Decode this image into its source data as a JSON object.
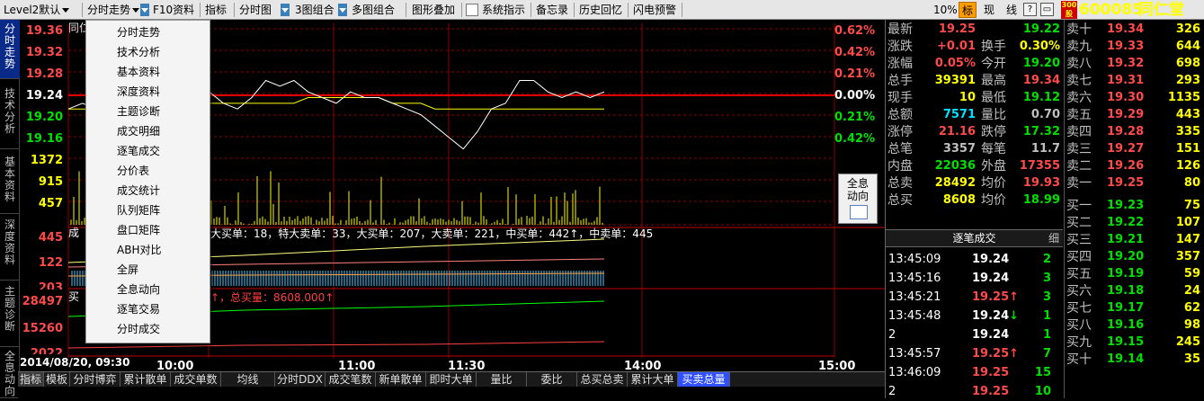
{
  "toolbar": {
    "items": [
      "Level2默认",
      "分时走势",
      "F10资料",
      "指标",
      "分时图",
      "3图组合",
      "多图组合",
      "图形叠加",
      "系统指示",
      "备忘录",
      "历史回忆",
      "闪电预警"
    ],
    "right": {
      "pct": "10%",
      "mark": "标",
      "xian": "现",
      "line": "线",
      "question": "?"
    },
    "badge": "300 股",
    "code": "600085",
    "name": "同仁堂"
  },
  "side_tabs": [
    {
      "label": "分时走势"
    },
    {
      "label": "技术分析"
    },
    {
      "label": "基本资料"
    },
    {
      "label": "深度资料"
    },
    {
      "label": "主题诊断"
    },
    {
      "label": "全息动向"
    }
  ],
  "chart": {
    "stock_name_short": "同仁",
    "price_labels": [
      "19.36",
      "19.32",
      "19.28",
      "19.24",
      "19.20",
      "19.16"
    ],
    "pct_labels": [
      "0.62%",
      "0.42%",
      "0.21%",
      "0.00%",
      "0.21%",
      "0.42%"
    ],
    "vol_labels": [
      "1372",
      "915",
      "457"
    ],
    "panel2_labels": [
      "445",
      "122",
      "203"
    ],
    "panel3_labels": [
      "28497",
      "15260",
      "2022"
    ],
    "time_labels": [
      "10:00",
      "11:00",
      "11:30",
      "14:00",
      "15:00"
    ],
    "date_label": "2014/08/20, 09:30",
    "legend1": "大买单：18，特大卖单：33，大买单：207，大卖单：221，中买单：442↑，中卖单：445",
    "legend1_prefix": "成",
    "legend2": "↑，总买量：8608.000↑",
    "legend2_prefix": "买",
    "qx_button": "全息动向",
    "colors": {
      "price_up": "#ff4a4a",
      "price_down": "#00e000",
      "price_line": "#ffffff",
      "avg_line": "#ffff00",
      "grid": "#8b0000",
      "vol": "#ffff00"
    }
  },
  "chart_data": {
    "type": "line",
    "title": "",
    "series": [
      {
        "name": "",
        "values": [
          19.22,
          19.23,
          19.22,
          19.21,
          19.19,
          19.17,
          19.2,
          19.23,
          19.24,
          19.23,
          19.25,
          19.23,
          19.22,
          19.24,
          19.27,
          19.26,
          19.27,
          19.25,
          19.24,
          19.23,
          19.25,
          19.24,
          19.24,
          19.23,
          19.22,
          19.21,
          19.19,
          19.17,
          19.15,
          19.18,
          19.22,
          19.23,
          19.27,
          19.27,
          19.25,
          19.24,
          19.25,
          19.24,
          19.25
        ]
      },
      {
        "name": "",
        "values": [
          19.22,
          19.22,
          19.22,
          19.22,
          19.22,
          19.22,
          19.22,
          19.22,
          19.22,
          19.22,
          19.23,
          19.23,
          19.23,
          19.23,
          19.23,
          19.23,
          19.23,
          19.24,
          19.24,
          19.24,
          19.24,
          19.24,
          19.24,
          19.23,
          19.23,
          19.23,
          19.22,
          19.22,
          19.22,
          19.22,
          19.22,
          19.22,
          19.22,
          19.22,
          19.22,
          19.22,
          19.22,
          19.22,
          19.22
        ]
      }
    ],
    "ylim": [
      19.14,
      19.37
    ],
    "xlabel": "",
    "ylabel": ""
  },
  "bottom_tabs": [
    "指标",
    "模板",
    "分时博弈",
    "累计散单",
    "成交单数",
    "均线",
    "分时DDX",
    "成交笔数",
    "新单散单",
    "即时大单",
    "量比",
    "委比",
    "总买总卖",
    "累计大单",
    "买卖总量"
  ],
  "context_menu": [
    "分时走势",
    "技术分析",
    "基本资料",
    "深度资料",
    "主题诊断",
    "成交明细",
    "逐笔成交",
    "分价表",
    "成交统计",
    "队列矩阵",
    "盘口矩阵",
    "ABH对比",
    "全屏",
    "全息动向",
    "逐笔交易",
    "分时成交"
  ],
  "quote": {
    "left": [
      {
        "k": "最新",
        "v": "19.25",
        "c": "red"
      },
      {
        "k": "涨跌",
        "v": "+0.01",
        "c": "red"
      },
      {
        "k": "涨幅",
        "v": "0.05%",
        "c": "red"
      },
      {
        "k": "总手",
        "v": "39391",
        "c": "yel"
      },
      {
        "k": "现手",
        "v": "10",
        "c": "yel"
      },
      {
        "k": "总额",
        "v": "7571",
        "c": "cyn"
      },
      {
        "k": "涨停",
        "v": "21.16",
        "c": "red"
      },
      {
        "k": "总笔",
        "v": "3357",
        "c": "gry"
      },
      {
        "k": "内盘",
        "v": "22036",
        "c": "grn"
      },
      {
        "k": "总卖",
        "v": "28492",
        "c": "yel"
      },
      {
        "k": "总买",
        "v": "8608",
        "c": "yel"
      }
    ],
    "mid": [
      {
        "k": "换手",
        "v": "0.30%",
        "c": "yel"
      },
      {
        "k": "今开",
        "v": "19.20",
        "c": "grn"
      },
      {
        "k": "最高",
        "v": "19.34",
        "c": "red"
      },
      {
        "k": "最低",
        "v": "19.12",
        "c": "grn"
      },
      {
        "k": "量比",
        "v": "0.70",
        "c": "gry"
      },
      {
        "k": "跌停",
        "v": "17.32",
        "c": "grn"
      },
      {
        "k": "每笔",
        "v": "11.7",
        "c": "gry"
      },
      {
        "k": "外盘",
        "v": "17355",
        "c": "red"
      },
      {
        "k": "均价",
        "v": "19.93",
        "c": "red"
      },
      {
        "k": "均价",
        "v": "18.99",
        "c": "grn"
      }
    ],
    "top_price": "19.22",
    "asks": [
      {
        "k": "卖十",
        "p": "19.34",
        "v": "326"
      },
      {
        "k": "卖九",
        "p": "19.33",
        "v": "644"
      },
      {
        "k": "卖八",
        "p": "19.32",
        "v": "698"
      },
      {
        "k": "卖七",
        "p": "19.31",
        "v": "293"
      },
      {
        "k": "卖六",
        "p": "19.30",
        "v": "1135"
      },
      {
        "k": "卖五",
        "p": "19.29",
        "v": "443"
      },
      {
        "k": "卖四",
        "p": "19.28",
        "v": "335"
      },
      {
        "k": "卖三",
        "p": "19.27",
        "v": "151"
      },
      {
        "k": "卖二",
        "p": "19.26",
        "v": "126"
      },
      {
        "k": "卖一",
        "p": "19.25",
        "v": "80"
      }
    ],
    "bids": [
      {
        "k": "买一",
        "p": "19.23",
        "v": "75"
      },
      {
        "k": "买二",
        "p": "19.22",
        "v": "107"
      },
      {
        "k": "买三",
        "p": "19.21",
        "v": "147"
      },
      {
        "k": "买四",
        "p": "19.20",
        "v": "357"
      },
      {
        "k": "买五",
        "p": "19.19",
        "v": "59"
      },
      {
        "k": "买六",
        "p": "19.18",
        "v": "24"
      },
      {
        "k": "买七",
        "p": "19.17",
        "v": "62"
      },
      {
        "k": "买八",
        "p": "19.16",
        "v": "98"
      },
      {
        "k": "买九",
        "p": "19.15",
        "v": "245"
      },
      {
        "k": "买十",
        "p": "19.14",
        "v": "35"
      }
    ],
    "trades_title": "逐笔成交",
    "trades_close": "细",
    "trades": [
      {
        "t": "13:45:09",
        "p": "19.24",
        "a": "",
        "v": "2"
      },
      {
        "t": "13:45:16",
        "p": "19.24",
        "a": "",
        "v": "3"
      },
      {
        "t": "13:45:21",
        "p": "19.25",
        "a": "↑",
        "v": "3"
      },
      {
        "t": "13:45:48",
        "p": "19.24",
        "a": "↓",
        "v": "1"
      },
      {
        "t": "2",
        "p": "19.24",
        "a": "",
        "v": "1"
      },
      {
        "t": "13:45:57",
        "p": "19.25",
        "a": "↑",
        "v": "7"
      },
      {
        "t": "13:46:09",
        "p": "19.25",
        "a": "",
        "v": "15"
      },
      {
        "t": "2",
        "p": "19.25",
        "a": "",
        "v": "10"
      }
    ]
  }
}
